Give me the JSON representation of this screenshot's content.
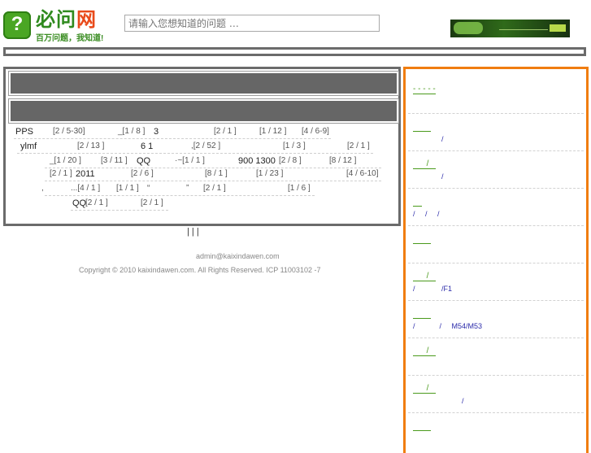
{
  "header": {
    "logo_badge": "?",
    "logo_main_a": "必问",
    "logo_main_b": "网",
    "logo_slogan": "百万问题，我知道!",
    "search_placeholder": "请输入您想知道的问题 …"
  },
  "rows": [
    {
      "cells": [
        {
          "t": "PPS",
          "big": true
        },
        {
          "t": "[2  / 5-30]"
        },
        {
          "t": "_[1  / 8  ]"
        },
        {
          "t": "3",
          "big": true
        },
        {
          "t": "[2  / 1  ]"
        },
        {
          "t": "[1  / 12  ]"
        },
        {
          "t": "[4  / 6-9]"
        }
      ]
    },
    {
      "cells": [
        {
          "t": "ylmf",
          "big": true
        },
        {
          "t": "[2  / 13  ]"
        },
        {
          "t": "6 1",
          "big": true
        },
        {
          "t": ",[2  / 52  ]"
        },
        {
          "t": "[1  / 3  ]"
        },
        {
          "t": "[2  / 1  ]"
        }
      ]
    },
    {
      "cells": [
        {
          "t": "_[1  / 20  ]"
        },
        {
          "t": "[3  / 11  ]"
        },
        {
          "t": "QQ",
          "big": true
        },
        {
          "t": "·~[1  / 1  ]"
        },
        {
          "t": "900 1300",
          "big": true
        },
        {
          "t": "[2  / 8  ]"
        },
        {
          "t": "[8  / 12  ]"
        }
      ]
    },
    {
      "cells": [
        {
          "t": "[2  / 1  ]"
        },
        {
          "t": "2011",
          "big": true
        },
        {
          "t": "[2  / 6  ]"
        },
        {
          "t": "[8  / 1  ]"
        },
        {
          "t": "[1  / 23  ]"
        },
        {
          "t": "[4  / 6-10]"
        }
      ]
    },
    {
      "cells": [
        {
          "t": ","
        },
        {
          "t": "...[4  / 1  ]"
        },
        {
          "t": "[1  / 1  ]"
        },
        {
          "t": "“"
        },
        {
          "t": "”"
        },
        {
          "t": "[2  / 1  ]"
        },
        {
          "t": "[1  / 6  ]"
        }
      ]
    },
    {
      "cells": [
        {
          "t": "QQ",
          "big": true
        },
        {
          "t": "[2  / 1  ]"
        },
        {
          "t": "[2  / 1  ]"
        }
      ]
    }
  ],
  "footer": {
    "pipes": "|    |    |",
    "email": "admin@kaixindawen.com",
    "copyright": "Copyright © 2010 kaixindawen.com. All Rights Reserved.  ICP 11003102 -7"
  },
  "sidebar": {
    "items": [
      {
        "head": "- - - - -",
        "body": ""
      },
      {
        "head": "        ",
        "body": "              /"
      },
      {
        "head": "      /   ",
        "body": "              /"
      },
      {
        "head": "    ",
        "body": "/     /     /"
      },
      {
        "head": "        ",
        "body": ""
      },
      {
        "head": "      /   ",
        "body": "/             /F1"
      },
      {
        "head": "        ",
        "body": "/            /     M54/M53"
      },
      {
        "head": "      /   ",
        "body": ""
      },
      {
        "head": "      /   ",
        "body": "                        /"
      },
      {
        "head": "        ",
        "body": ""
      }
    ]
  },
  "colors": {
    "panel_border": "#6b6b6b",
    "title_bar": "#666666",
    "sidebar_border": "#f07d10",
    "sidebar_head": "#4a9a1c",
    "sidebar_link": "#2b2baa",
    "logo_green": "#2f8a1e",
    "logo_accent": "#e94a1a"
  }
}
